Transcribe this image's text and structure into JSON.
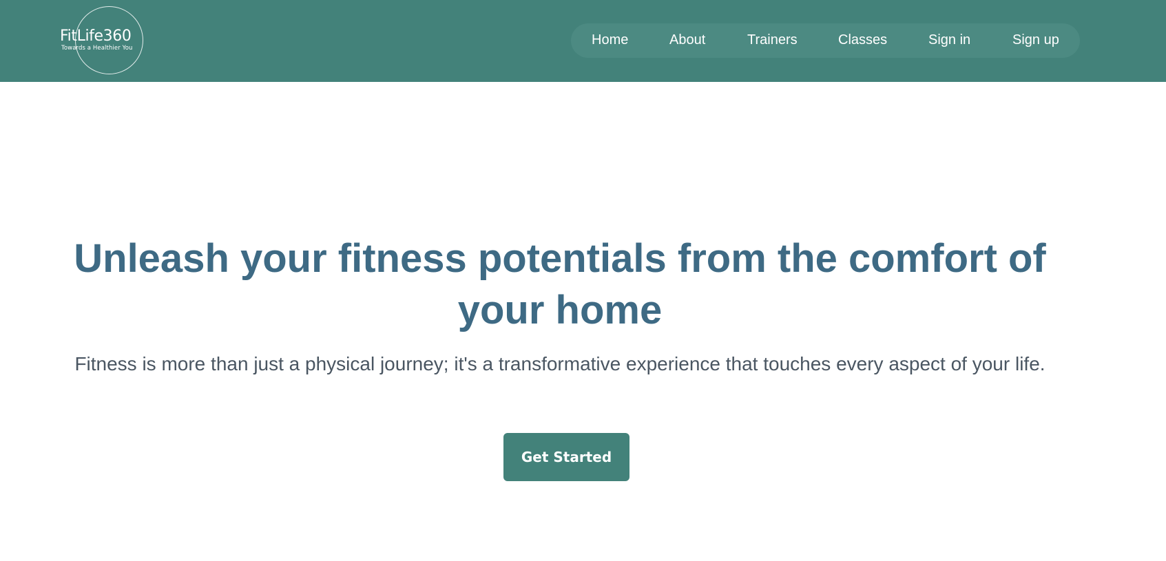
{
  "colors": {
    "header_bg": "#43827a",
    "nav_pill_bg": "#4c8a82",
    "title": "#3e6a84",
    "subtitle": "#4a5662",
    "button_bg": "#43827a"
  },
  "logo": {
    "name": "FitLife360",
    "tagline": "Towards a Healthier You"
  },
  "nav": {
    "items": [
      {
        "label": "Home"
      },
      {
        "label": "About"
      },
      {
        "label": "Trainers"
      },
      {
        "label": "Classes"
      },
      {
        "label": "Sign in"
      },
      {
        "label": "Sign up"
      }
    ]
  },
  "hero": {
    "title": "Unleash your fitness potentials from the comfort of your home",
    "subtitle": "Fitness is more than just a physical journey; it's a transformative experience that touches every aspect of your life.",
    "cta_label": "Get Started"
  }
}
